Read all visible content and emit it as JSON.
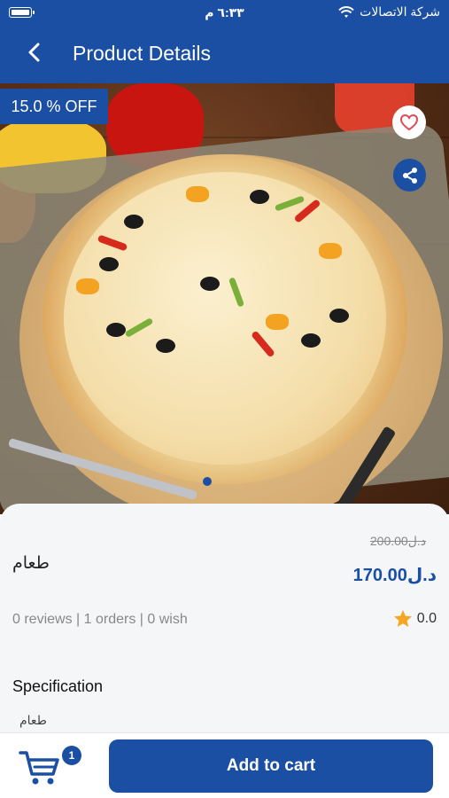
{
  "status_bar": {
    "time": "٦:٣٣ م",
    "carrier": "شركة الاتصالات"
  },
  "header": {
    "title": "Product Details"
  },
  "hero": {
    "discount_label": "15.0 % OFF"
  },
  "product": {
    "name": "طعام",
    "old_price": "200.00د.ل",
    "price": "170.00د.ل",
    "stats": "0 reviews | 1 orders | 0 wish",
    "rating": "0.0"
  },
  "specification": {
    "title": "Specification",
    "text": "طعام"
  },
  "bottom_bar": {
    "cart_count": "1",
    "add_to_cart_label": "Add to cart"
  },
  "colors": {
    "primary": "#1a4fa3",
    "rating_star": "#f5a623",
    "fav_heart": "#e04a5a"
  },
  "icons": [
    "battery-icon",
    "wifi-icon",
    "back-arrow-icon",
    "heart-icon",
    "share-icon",
    "star-icon",
    "cart-icon"
  ]
}
